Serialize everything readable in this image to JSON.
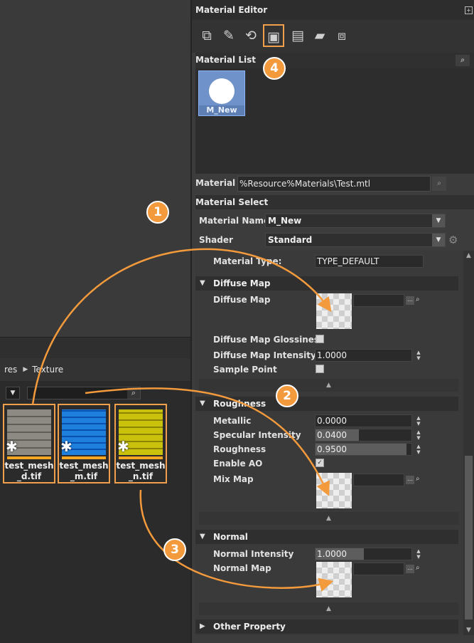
{
  "browser": {
    "breadcrumb": {
      "root": "res",
      "current": "Texture"
    },
    "search_placeholder": "",
    "assets": [
      {
        "name": "test_mesh_d.tif"
      },
      {
        "name": "test_mesh_m.tif"
      },
      {
        "name": "test_mesh_n.tif"
      }
    ]
  },
  "editor": {
    "title": "Material Editor",
    "material_list_title": "Material List",
    "material_item": "M_New",
    "material_file_label": "Material F",
    "material_file_path": "%Resource%Materials\\Test.mtl",
    "material_select_title": "Material Select",
    "material_name_label": "Material Name",
    "material_name_value": "M_New",
    "shader_label": "Shader",
    "shader_value": "Standard",
    "material_type_label": "Material Type:",
    "material_type_value": "TYPE_DEFAULT",
    "diffuse": {
      "title": "Diffuse Map",
      "map_label": "Diffuse Map",
      "glossiness_label": "Diffuse Map Glossiness",
      "intensity_label": "Diffuse Map Intensity",
      "intensity_value": "1.0000",
      "sample_point_label": "Sample Point"
    },
    "roughness": {
      "title": "Roughness",
      "metallic_label": "Metallic",
      "metallic_value": "0.0000",
      "specular_label": "Specular Intensity",
      "specular_value": "0.0400",
      "specular_fill": 0.45,
      "roughness_label": "Roughness",
      "roughness_value": "0.9500",
      "roughness_fill": 0.95,
      "enable_ao_label": "Enable AO",
      "enable_ao_checked": true,
      "mix_map_label": "Mix Map"
    },
    "normal": {
      "title": "Normal",
      "intensity_label": "Normal Intensity",
      "intensity_value": "1.0000",
      "intensity_fill": 0.5,
      "map_label": "Normal Map"
    },
    "other_title": "Other Property"
  },
  "steps": [
    "1",
    "2",
    "3",
    "4"
  ],
  "colors": {
    "accent": "#f39a3c",
    "selection": "#6e92c9"
  }
}
